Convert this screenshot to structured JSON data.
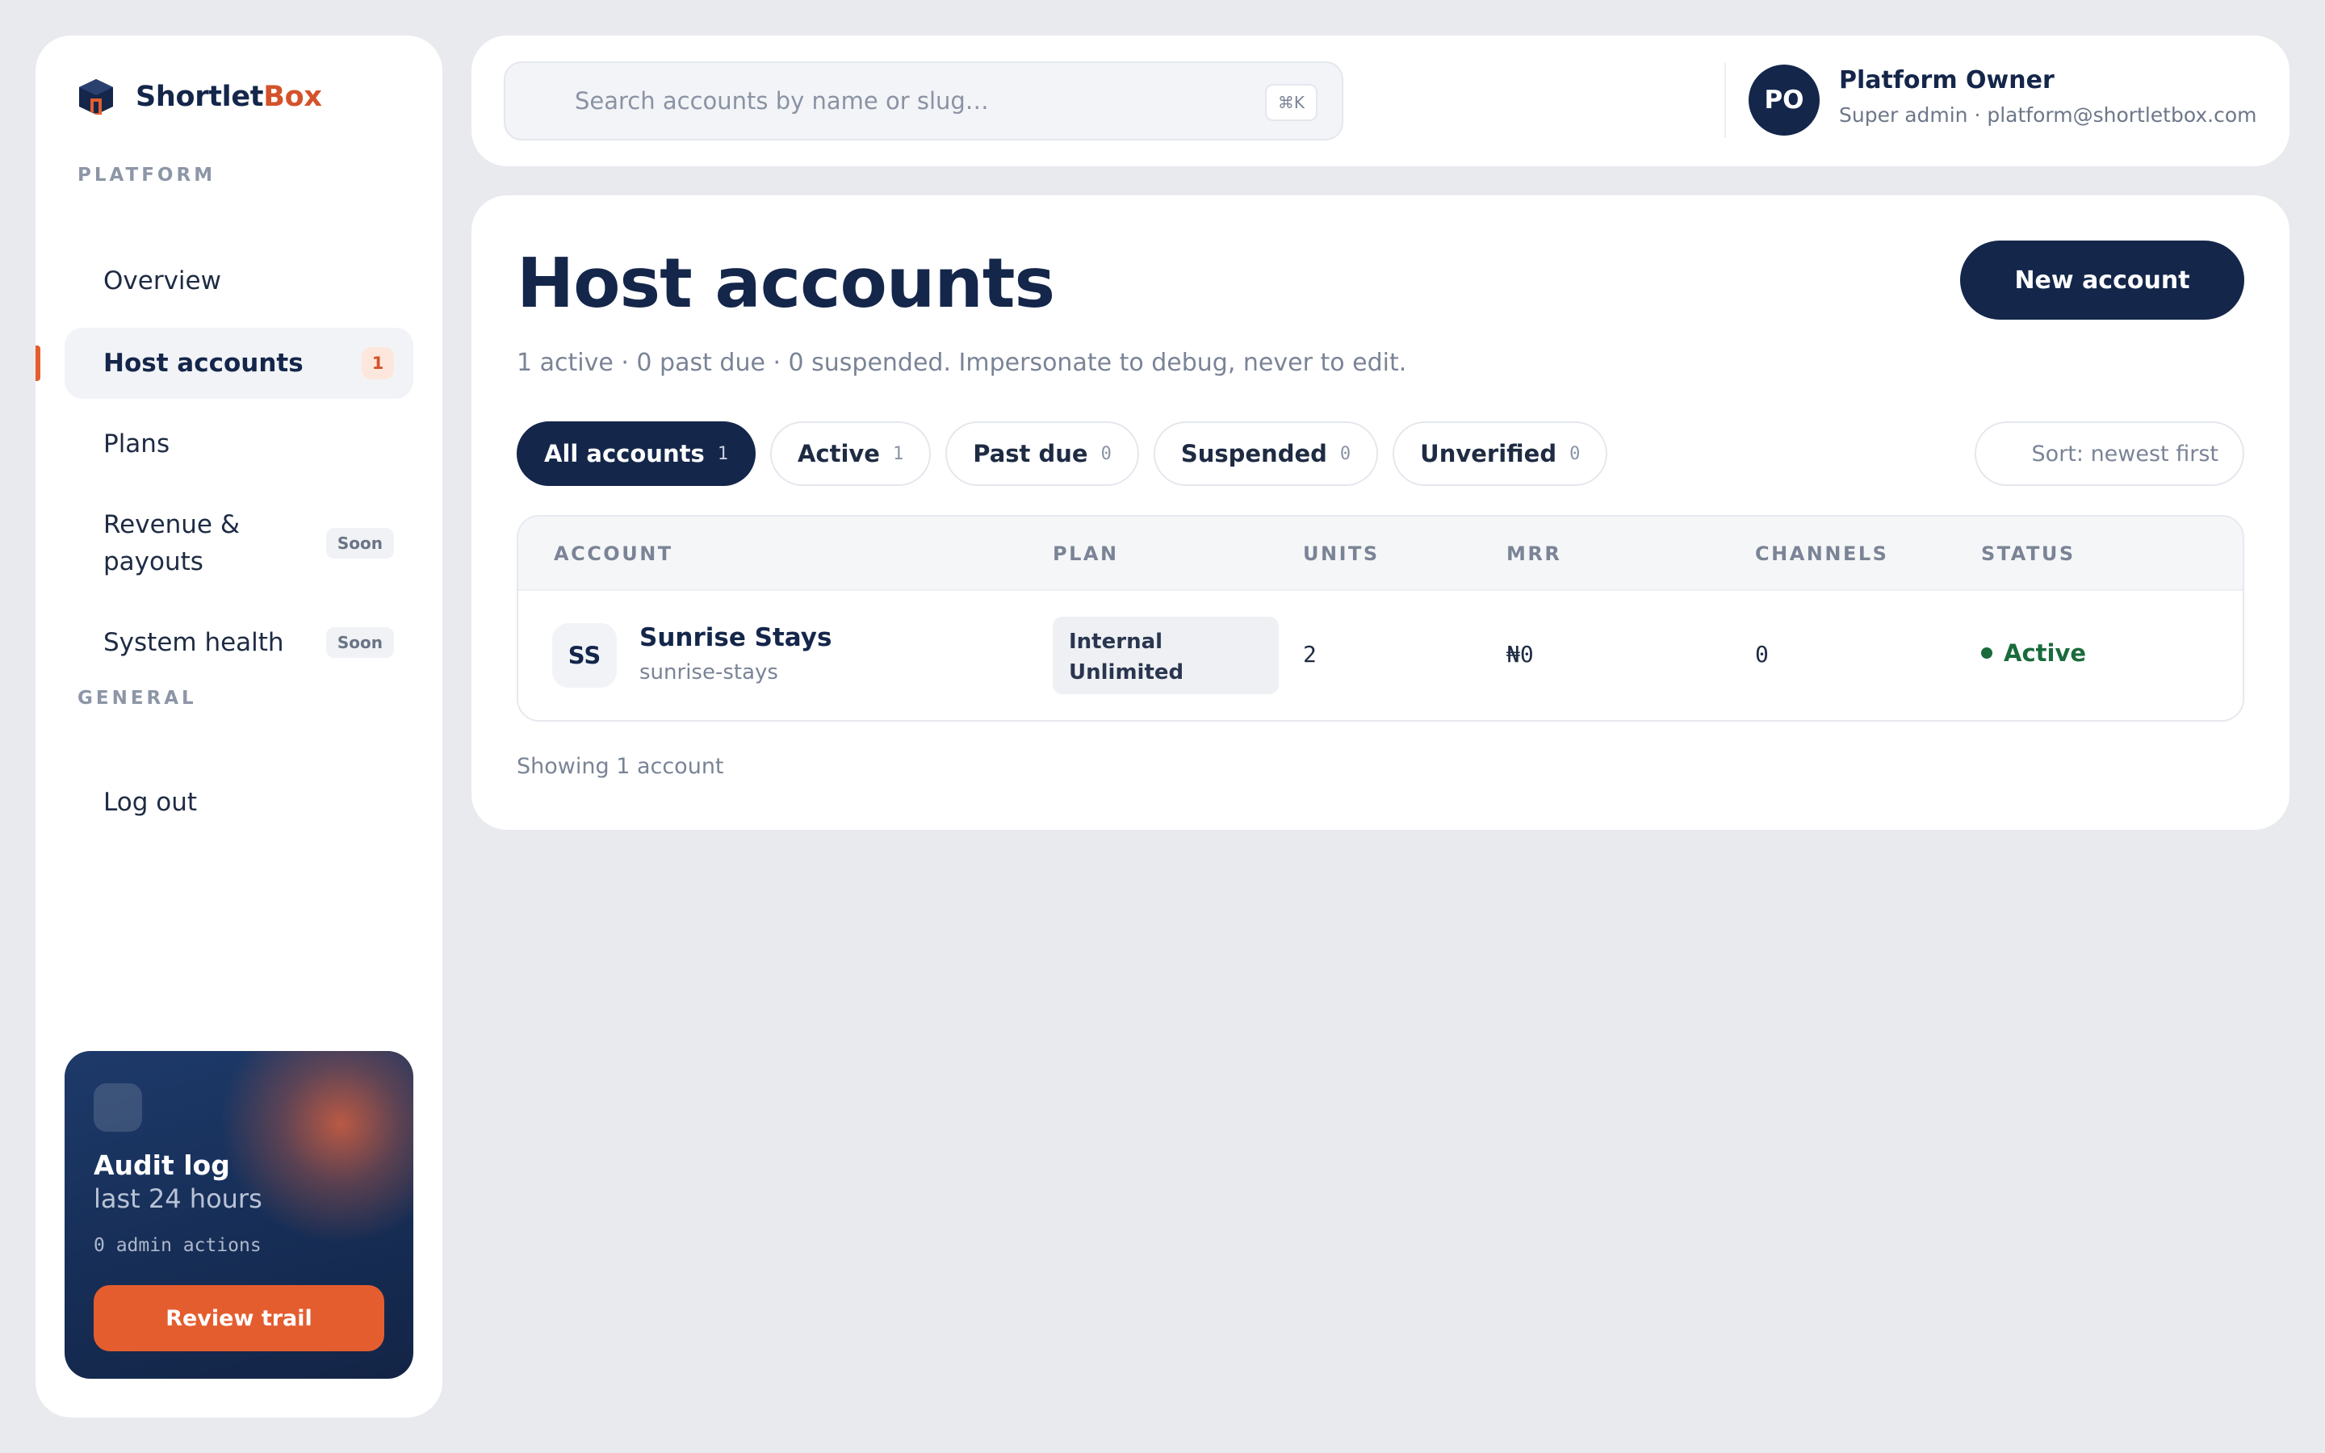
{
  "brand": {
    "name_part1": "Shortlet",
    "name_part2": "Box"
  },
  "sidebar": {
    "platform_label": "PLATFORM",
    "general_label": "GENERAL",
    "items": [
      {
        "label": "Overview"
      },
      {
        "label": "Host accounts",
        "badge": "1",
        "active": true
      },
      {
        "label": "Plans"
      },
      {
        "label": "Revenue &\npayouts",
        "badge": "Soon"
      },
      {
        "label": "System health",
        "badge": "Soon"
      },
      {
        "label": "Log out"
      }
    ],
    "audit": {
      "title": "Audit log",
      "subtitle": "last 24 hours",
      "meta": "0 admin actions",
      "button": "Review trail"
    }
  },
  "topbar": {
    "search_placeholder": "Search accounts by name or slug…",
    "shortcut": "⌘K",
    "user_initials": "PO",
    "user_name": "Platform Owner",
    "user_sub": "Super admin · platform@shortletbox.com"
  },
  "main": {
    "title": "Host accounts",
    "subtitle": "1 active · 0 past due · 0 suspended. Impersonate to debug, never to edit.",
    "new_button": "New account",
    "tabs": [
      {
        "label": "All accounts",
        "count": "1",
        "active": true
      },
      {
        "label": "Active",
        "count": "1"
      },
      {
        "label": "Past due",
        "count": "0"
      },
      {
        "label": "Suspended",
        "count": "0"
      },
      {
        "label": "Unverified",
        "count": "0"
      }
    ],
    "sort_label": "Sort: newest first",
    "table": {
      "headers": [
        "ACCOUNT",
        "PLAN",
        "UNITS",
        "MRR",
        "CHANNELS",
        "STATUS"
      ],
      "rows": [
        {
          "initials": "SS",
          "name": "Sunrise Stays",
          "slug": "sunrise-stays",
          "plan_line1": "Internal",
          "plan_line2": "Unlimited",
          "units": "2",
          "mrr": "₦0",
          "channels": "0",
          "status": "Active"
        }
      ]
    },
    "footer": "Showing 1 account"
  },
  "colors": {
    "navy": "#14264a",
    "accent": "#e45d2f",
    "success": "#1a6b3c",
    "background": "#e9eaee"
  }
}
